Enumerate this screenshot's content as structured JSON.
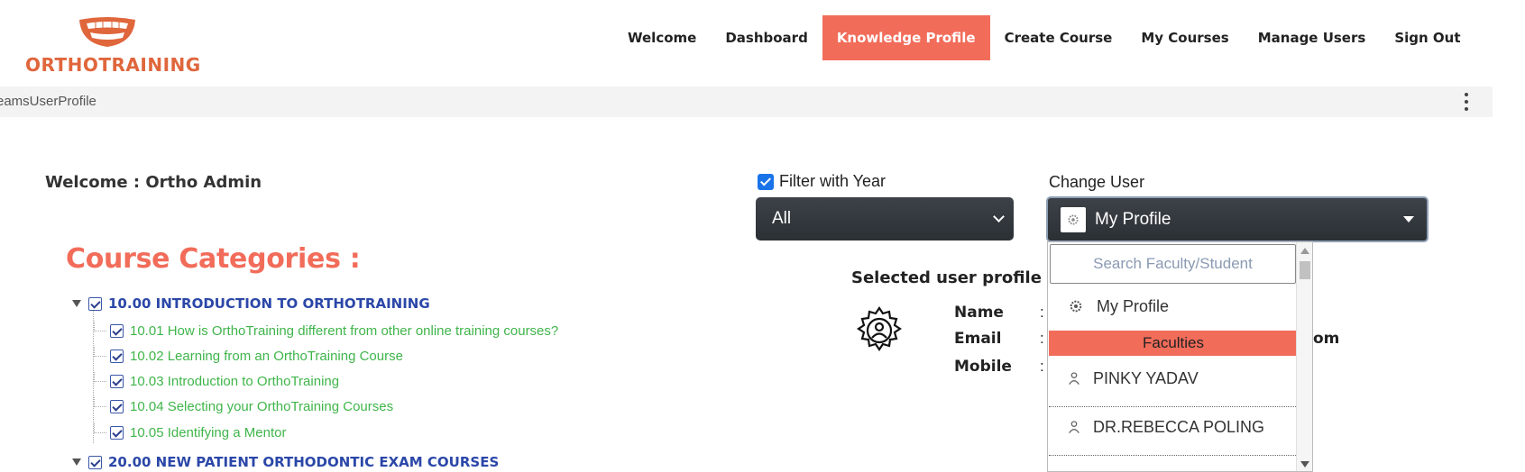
{
  "brand": {
    "name": "ORTHOTRAINING"
  },
  "nav": {
    "items": [
      {
        "label": "Welcome"
      },
      {
        "label": "Dashboard"
      },
      {
        "label": "Knowledge Profile"
      },
      {
        "label": "Create Course"
      },
      {
        "label": "My Courses"
      },
      {
        "label": "Manage Users"
      },
      {
        "label": "Sign Out"
      }
    ],
    "active": "Knowledge Profile"
  },
  "breadcrumb": {
    "text": "eamsUserProfile"
  },
  "welcome": {
    "text": "Welcome : Ortho Admin"
  },
  "categories": {
    "title": "Course Categories :",
    "groups": [
      {
        "label": "10.00 INTRODUCTION TO ORTHOTRAINING",
        "children": [
          "10.01 How is OrthoTraining different from other online training courses?",
          "10.02 Learning from an OrthoTraining Course",
          "10.03 Introduction to OrthoTraining",
          "10.04 Selecting your OrthoTraining Courses",
          "10.05 Identifying a Mentor"
        ]
      },
      {
        "label": "20.00 NEW PATIENT ORTHODONTIC EXAM COURSES",
        "children": []
      }
    ]
  },
  "filter": {
    "label": "Filter with Year",
    "checked": true,
    "year_value": "All"
  },
  "change_user": {
    "label": "Change User",
    "selected": "My Profile",
    "search_placeholder": "Search Faculty/Student",
    "options": {
      "my_profile": "My Profile",
      "group_faculties": "Faculties",
      "faculty_1": "PINKY YADAV",
      "faculty_2": "DR.REBECCA POLING"
    }
  },
  "profile": {
    "title": "Selected user profile",
    "fields": {
      "name": "Name",
      "email": "Email",
      "mobile": "Mobile"
    },
    "colon": ":",
    "email_tail": "om"
  },
  "colors": {
    "accent": "#f26c5a",
    "brand": "#e0663c",
    "parent_link": "#2b47a8",
    "child_link": "#3fb54a"
  }
}
